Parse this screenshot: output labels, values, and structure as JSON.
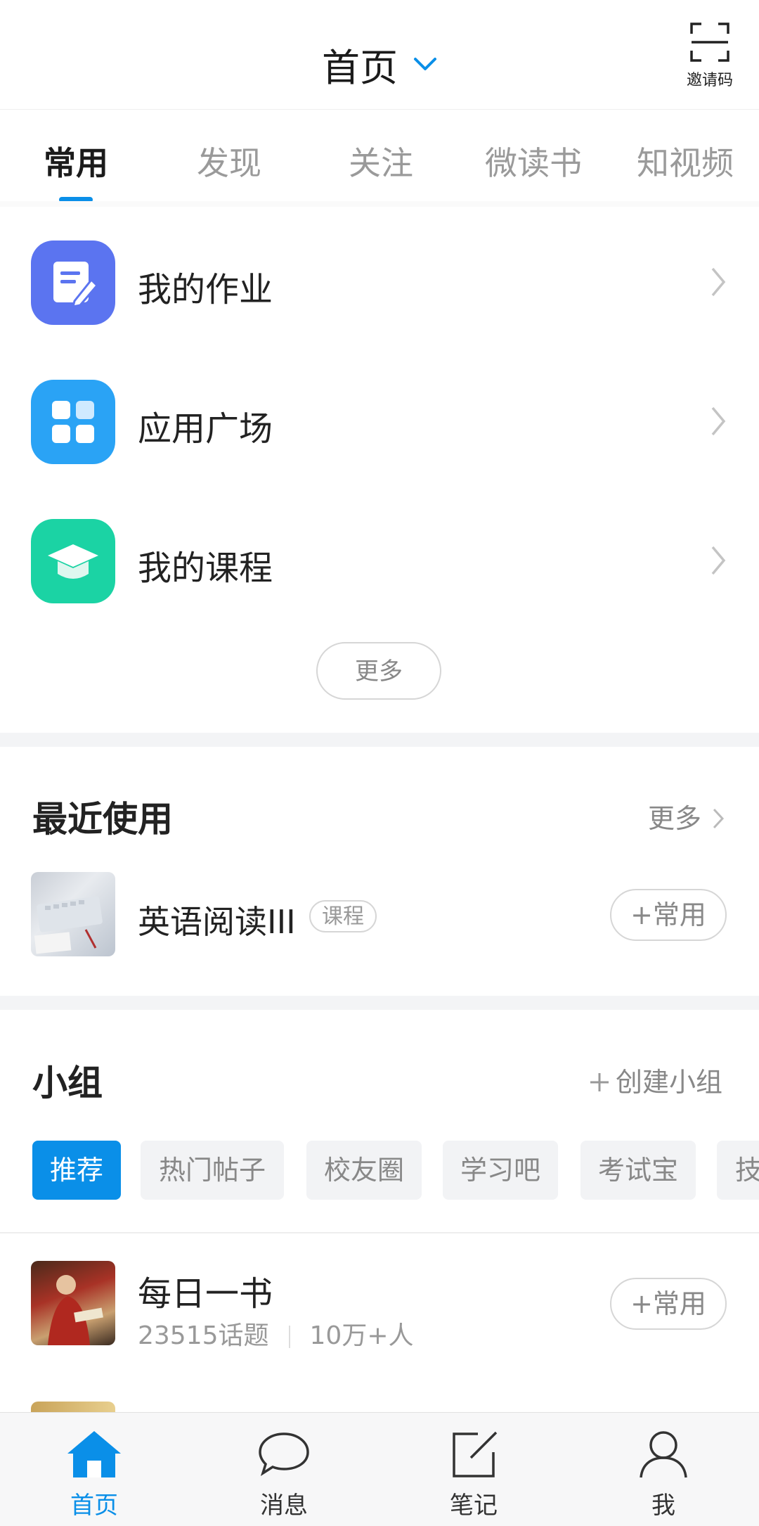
{
  "header": {
    "title": "首页",
    "invite_label": "邀请码"
  },
  "tabs": [
    {
      "label": "常用",
      "active": true
    },
    {
      "label": "发现",
      "active": false
    },
    {
      "label": "关注",
      "active": false
    },
    {
      "label": "微读书",
      "active": false
    },
    {
      "label": "知视频",
      "active": false
    }
  ],
  "common": {
    "items": [
      {
        "label": "我的作业",
        "icon": "homework-icon",
        "color": "#5b74f0"
      },
      {
        "label": "应用广场",
        "icon": "app-grid-icon",
        "color": "#2aa3f5"
      },
      {
        "label": "我的课程",
        "icon": "graduation-cap-icon",
        "color": "#1bd3a4"
      }
    ],
    "more_label": "更多"
  },
  "recent": {
    "title": "最近使用",
    "more_label": "更多",
    "items": [
      {
        "name": "英语阅读III",
        "badge": "课程",
        "action": "+常用"
      }
    ]
  },
  "groups": {
    "title": "小组",
    "create_label": "创建小组",
    "chips": [
      {
        "label": "推荐",
        "active": true
      },
      {
        "label": "热门帖子",
        "active": false
      },
      {
        "label": "校友圈",
        "active": false
      },
      {
        "label": "学习吧",
        "active": false
      },
      {
        "label": "考试宝",
        "active": false
      },
      {
        "label": "技",
        "active": false
      }
    ],
    "items": [
      {
        "name": "每日一书",
        "topics": "23515话题",
        "members": "10万+人",
        "action": "+常用"
      }
    ]
  },
  "bottom_nav": [
    {
      "label": "首页",
      "icon": "home-icon",
      "active": true
    },
    {
      "label": "消息",
      "icon": "message-icon",
      "active": false
    },
    {
      "label": "笔记",
      "icon": "note-icon",
      "active": false
    },
    {
      "label": "我",
      "icon": "user-icon",
      "active": false
    }
  ],
  "colors": {
    "accent": "#0a8fe8",
    "separator": "#f3f4f6"
  }
}
